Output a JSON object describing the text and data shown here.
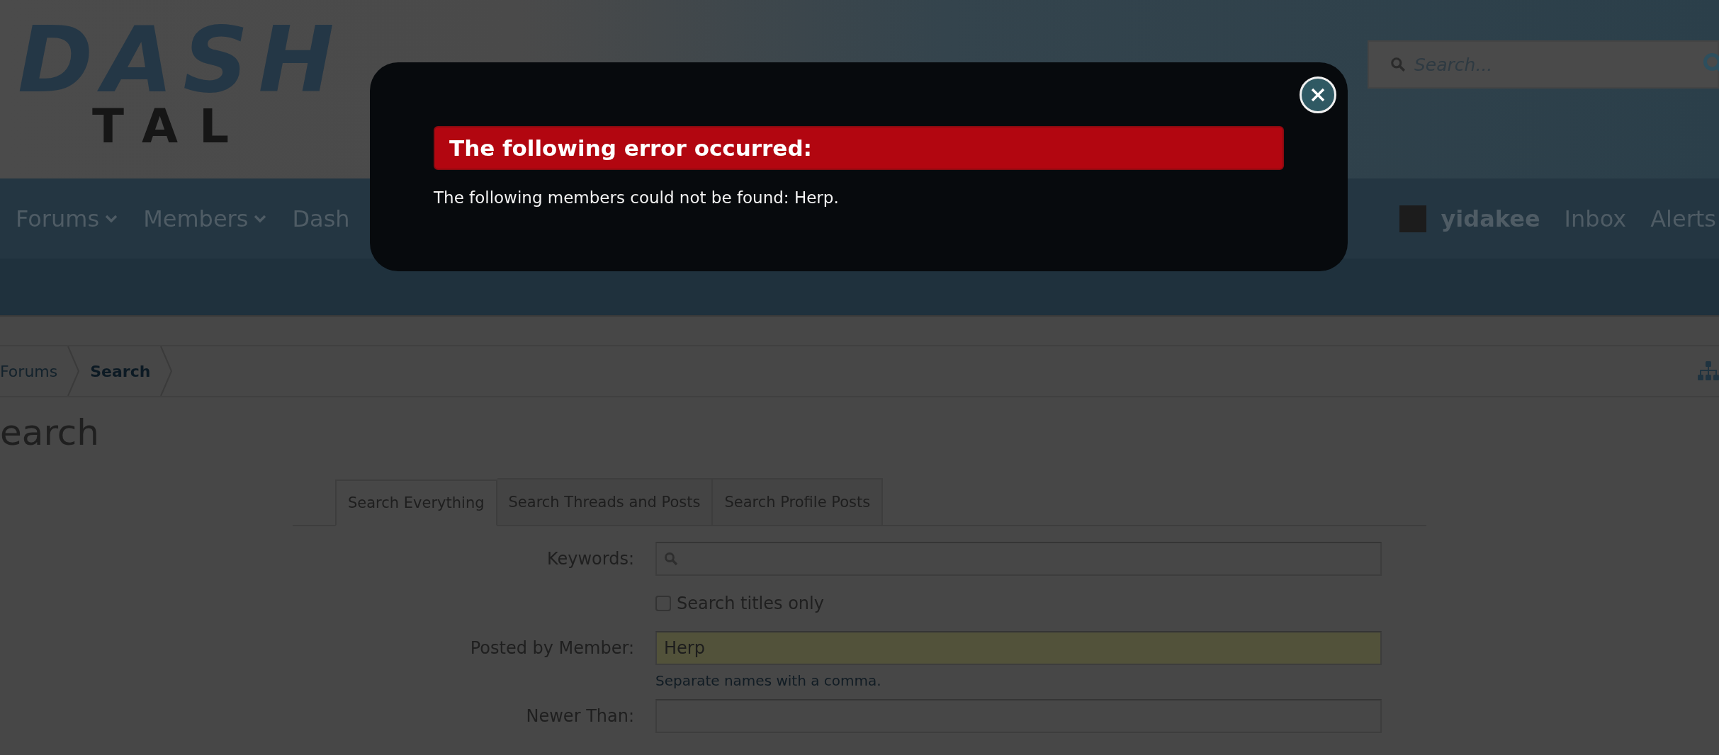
{
  "logo": {
    "line_1": "DASH",
    "line_2": "TAL"
  },
  "search": {
    "placeholder": "Search..."
  },
  "nav": {
    "items": [
      {
        "label": "Forums",
        "dropdown": true
      },
      {
        "label": "Members",
        "dropdown": true
      },
      {
        "label": "Dash",
        "dropdown": false
      }
    ],
    "user": {
      "name": "yidakee"
    },
    "links": [
      "Inbox",
      "Alerts"
    ]
  },
  "breadcrumb": [
    {
      "label": "Forums",
      "current": false
    },
    {
      "label": "Search",
      "current": true
    }
  ],
  "page_title": "earch",
  "tabs": [
    {
      "label": "Search Everything",
      "selected": true
    },
    {
      "label": "Search Threads and Posts",
      "selected": false
    },
    {
      "label": "Search Profile Posts",
      "selected": false
    }
  ],
  "form": {
    "rows": [
      {
        "kind": "search",
        "label": "Keywords:"
      },
      {
        "kind": "checkbox",
        "label": "Search titles only",
        "checked": false
      },
      {
        "kind": "text",
        "label": "Posted by Member:",
        "value": "Herp",
        "hint": "Separate names with a comma.",
        "highlighted": true
      },
      {
        "kind": "text",
        "label": "Newer Than:",
        "highlighted": false
      }
    ]
  },
  "error_dialog": {
    "title": "The following error occurred:",
    "message": "The following members could not be found: Herp."
  }
}
